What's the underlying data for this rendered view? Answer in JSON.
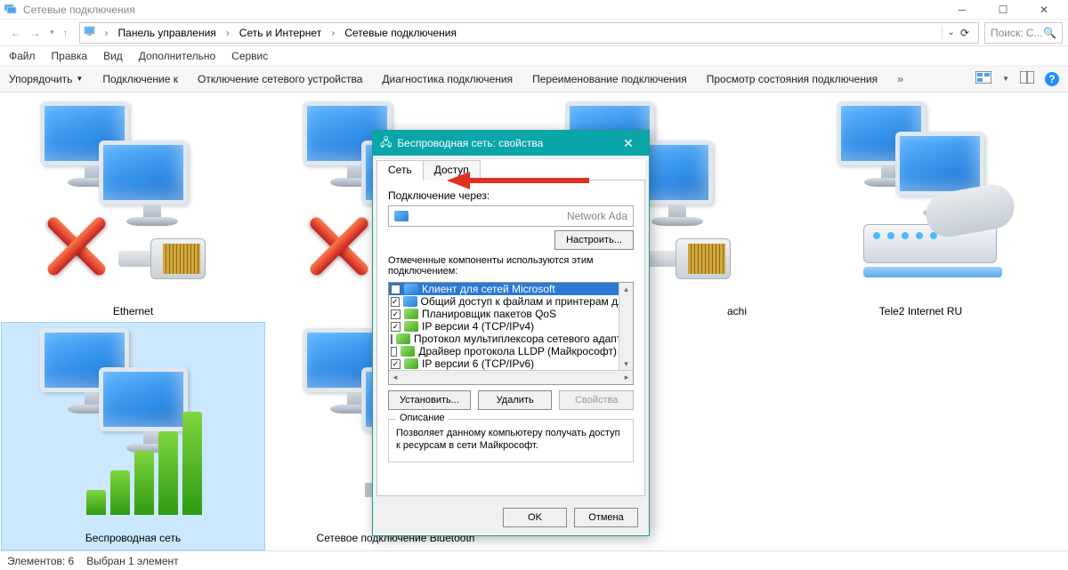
{
  "titlebar": {
    "text": "Сетевые подключения"
  },
  "breadcrumb": {
    "seg1": "Панель управления",
    "seg2": "Сеть и Интернет",
    "seg3": "Сетевые подключения"
  },
  "search": {
    "placeholder": "Поиск: С..."
  },
  "menubar": {
    "file": "Файл",
    "edit": "Правка",
    "view": "Вид",
    "extra": "Дополнительно",
    "service": "Сервис"
  },
  "cmdbar": {
    "organize": "Упорядочить",
    "connect": "Подключение к",
    "disable": "Отключение сетевого устройства",
    "diagnose": "Диагностика подключения",
    "rename": "Переименование подключения",
    "status": "Просмотр состояния подключения",
    "more": "»"
  },
  "connections": {
    "c0": "Ethernet",
    "c1": "Беспроводная сеть",
    "c2": "Сетевое подключение Bluetooth",
    "c3_partial": "achi",
    "c4": "Tele2 Internet RU"
  },
  "statusbar": {
    "count": "Элементов: 6",
    "selected": "Выбран 1 элемент"
  },
  "dialog": {
    "title": "Беспроводная сеть: свойства",
    "tab_net": "Сеть",
    "tab_access": "Доступ",
    "connect_via": "Подключение через:",
    "adapter": "Network Ada",
    "configure": "Настроить...",
    "components_label": "Отмеченные компоненты используются этим подключением:",
    "items": {
      "i0": "Клиент для сетей Microsoft",
      "i1": "Общий доступ к файлам и принтерам для сетей Mi",
      "i2": "Планировщик пакетов QoS",
      "i3": "IP версии 4 (TCP/IPv4)",
      "i4": "Протокол мультиплексора сетевого адаптера (Ма",
      "i5": "Драйвер протокола LLDP (Майкрософт)",
      "i6": "IP версии 6 (TCP/IPv6)"
    },
    "install": "Установить...",
    "remove": "Удалить",
    "props": "Свойства",
    "desc_legend": "Описание",
    "desc_text": "Позволяет данному компьютеру получать доступ к ресурсам в сети Майкрософт.",
    "ok": "OK",
    "cancel": "Отмена"
  }
}
